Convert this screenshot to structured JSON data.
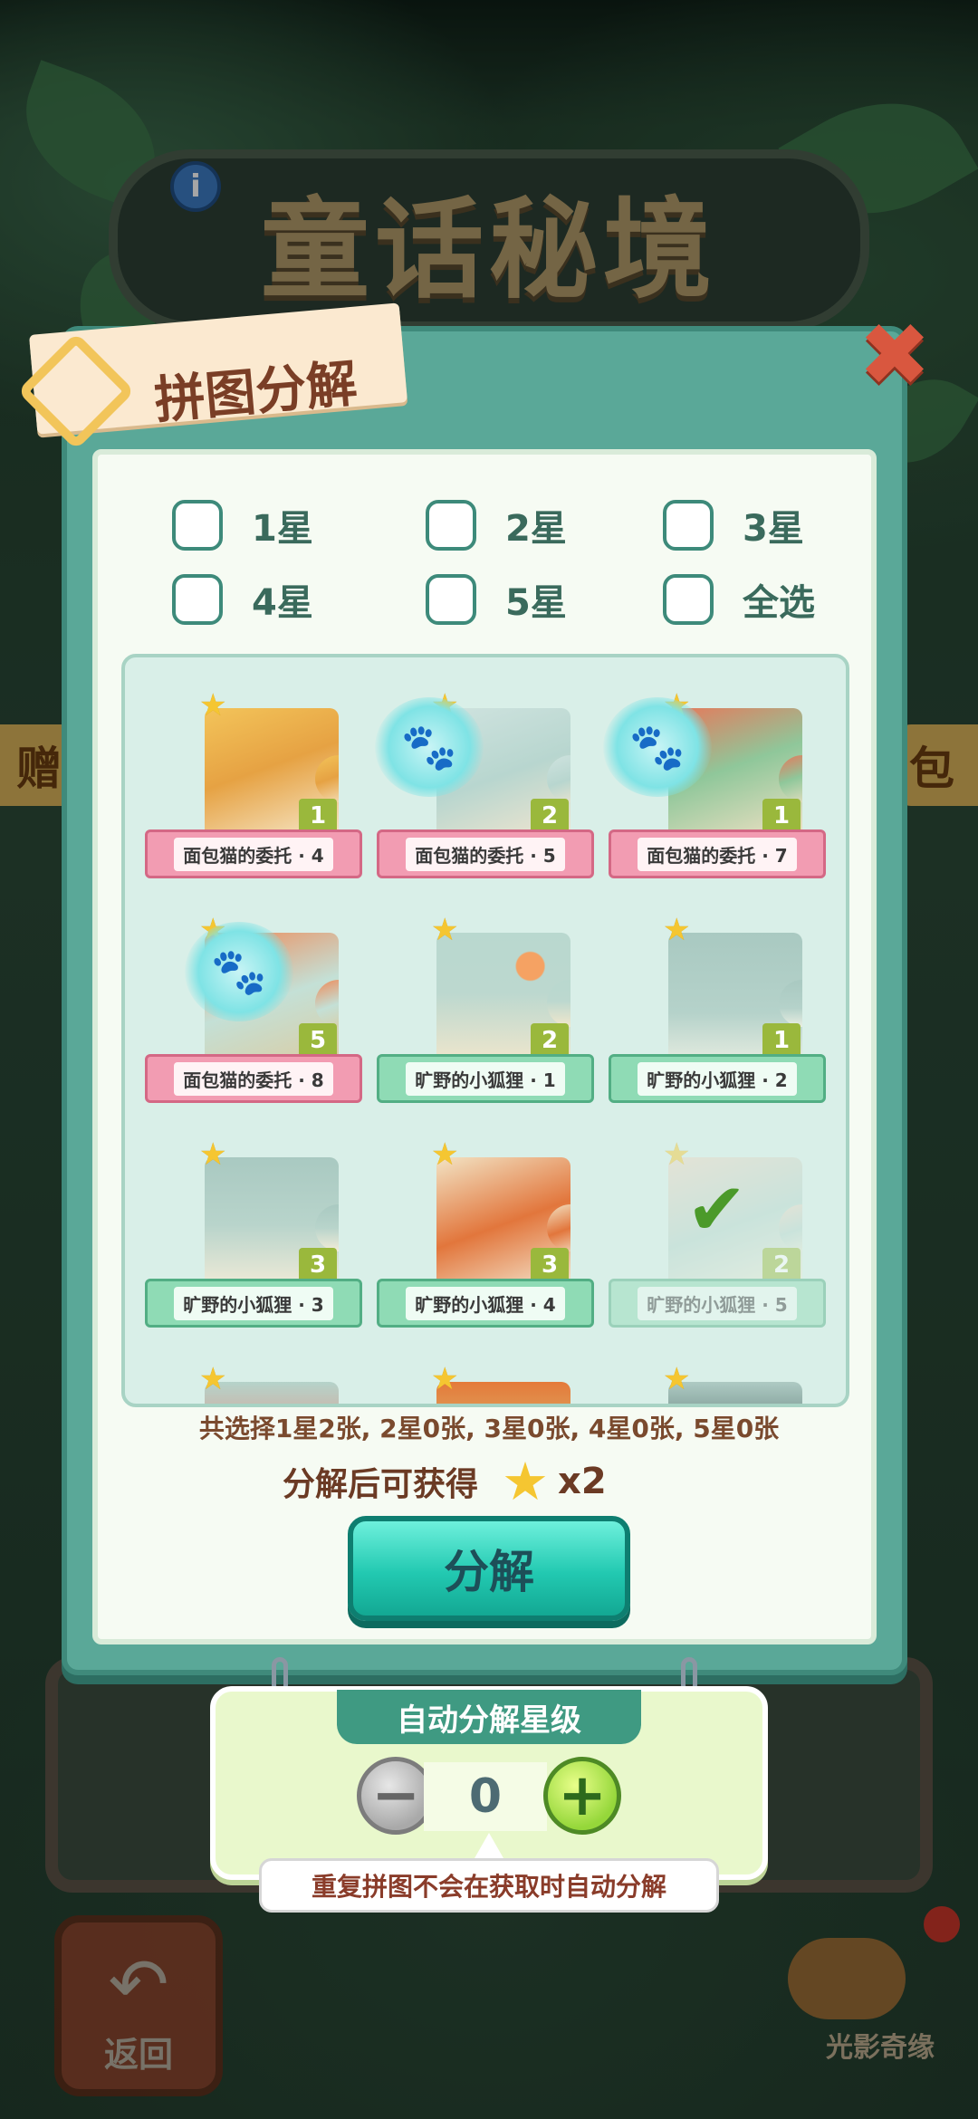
{
  "background": {
    "title": "童话秘境",
    "left_tab_text": "赠",
    "right_tab_text": "包",
    "back_label": "返回",
    "brand_text": "光影奇缘"
  },
  "modal": {
    "title": "拼图分解",
    "close_icon": "close-x-icon"
  },
  "filters": [
    {
      "label": "1星",
      "checked": false
    },
    {
      "label": "2星",
      "checked": false
    },
    {
      "label": "3星",
      "checked": false
    },
    {
      "label": "4星",
      "checked": false
    },
    {
      "label": "5星",
      "checked": false
    },
    {
      "label": "全选",
      "checked": false
    }
  ],
  "cards": [
    {
      "name": "面包猫的委托 · 4",
      "stars": 1,
      "count": "1",
      "theme": "pink",
      "selected": false,
      "paw": false
    },
    {
      "name": "面包猫的委托 · 5",
      "stars": 1,
      "count": "2",
      "theme": "pink",
      "selected": false,
      "paw": true
    },
    {
      "name": "面包猫的委托 · 7",
      "stars": 1,
      "count": "1",
      "theme": "pink",
      "selected": false,
      "paw": true
    },
    {
      "name": "面包猫的委托 · 8",
      "stars": 1,
      "count": "5",
      "theme": "pink",
      "selected": false,
      "paw": true
    },
    {
      "name": "旷野的小狐狸 · 1",
      "stars": 1,
      "count": "2",
      "theme": "green",
      "selected": false,
      "paw": false
    },
    {
      "name": "旷野的小狐狸 · 2",
      "stars": 1,
      "count": "1",
      "theme": "green",
      "selected": false,
      "paw": false
    },
    {
      "name": "旷野的小狐狸 · 3",
      "stars": 1,
      "count": "3",
      "theme": "green",
      "selected": false,
      "paw": false
    },
    {
      "name": "旷野的小狐狸 · 4",
      "stars": 1,
      "count": "3",
      "theme": "green",
      "selected": false,
      "paw": false
    },
    {
      "name": "旷野的小狐狸 · 5",
      "stars": 1,
      "count": "2",
      "theme": "green",
      "selected": true,
      "paw": false
    }
  ],
  "summary": "共选择1星2张, 2星0张, 3星0张, 4星0张, 5星0张",
  "reward": {
    "label": "分解后可获得",
    "icon": "star-icon",
    "amount": "x2"
  },
  "decompose_button": "分解",
  "auto_decompose": {
    "title": "自动分解星级",
    "level": "0",
    "tip": "重复拼图不会在获取时自动分解"
  },
  "colors": {
    "modal_frame": "#5aa898",
    "pink_ribbon": "#f29cb2",
    "green_ribbon": "#8fdbb5",
    "button_teal": "#22c9b1",
    "star_gold": "#f5c631"
  }
}
